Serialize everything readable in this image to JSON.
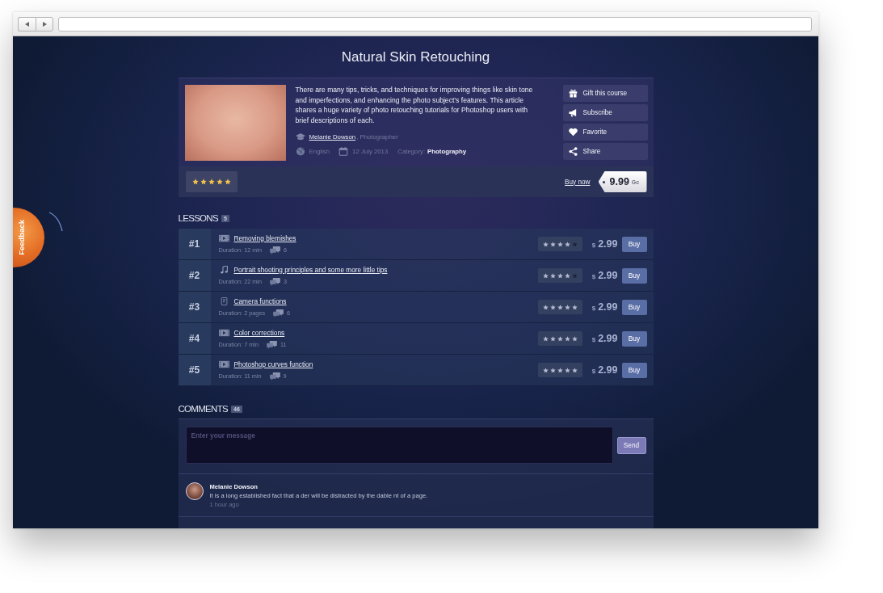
{
  "page": {
    "title": "Natural Skin Retouching"
  },
  "course": {
    "description": "There are many tips, tricks, and techniques for improving things like skin tone and imperfections, and enhancing the photo subject’s features. This article shares a huge variety of photo retouching tutorials for Photoshop users with brief descriptions of each.",
    "author": "Melanie Dowson",
    "author_role": ", Photographer",
    "language": "English",
    "date": "12 July 2013",
    "category_label": "Category:",
    "category": "Photography",
    "actions": [
      {
        "kind": "gift",
        "label": "Gift this course"
      },
      {
        "kind": "subscribe",
        "label": "Subscribe"
      },
      {
        "kind": "favorite",
        "label": "Favorite"
      },
      {
        "kind": "share",
        "label": "Share"
      }
    ],
    "rating": {
      "stars": 5
    },
    "buy_link": "Buy now",
    "price": {
      "amount": "9.99",
      "currency": "Gc"
    }
  },
  "lessons": {
    "title": "LESSONS",
    "count": "5",
    "items": [
      {
        "number": "#1",
        "kind": "video",
        "title": "Removing blemishes",
        "duration": "Duration: 12 min",
        "comments": "6",
        "stars": 4,
        "currency": "$",
        "price": "2.99",
        "buy_button": "Buy"
      },
      {
        "number": "#2",
        "kind": "audio",
        "title": "Portrait shooting principles and some more little tips",
        "duration": "Duration: 22 min",
        "comments": "3",
        "stars": 4,
        "currency": "$",
        "price": "2.99",
        "buy_button": "Buy"
      },
      {
        "number": "#3",
        "kind": "document",
        "title": "Camera functions",
        "duration": "Duration: 2 pages",
        "comments": "6",
        "stars": 5,
        "currency": "$",
        "price": "2.99",
        "buy_button": "Buy"
      },
      {
        "number": "#4",
        "kind": "video",
        "title": "Color corrections",
        "duration": "Duration: 7 min",
        "comments": "11",
        "stars": 5,
        "currency": "$",
        "price": "2.99",
        "buy_button": "Buy"
      },
      {
        "number": "#5",
        "kind": "video",
        "title": "Photoshop curves function",
        "duration": "Duration: 11 min",
        "comments": "9",
        "stars": 5,
        "currency": "$",
        "price": "2.99",
        "buy_button": "Buy"
      }
    ]
  },
  "comments": {
    "title": "COMMENTS",
    "count": "46",
    "input": {
      "placeholder": "Enter your message"
    },
    "send_button": "Send",
    "items": [
      {
        "author": "Melanie Dowson",
        "text": "It is a long established fact that a der will be distracted by the dable nt of a page.",
        "time": "1 hour ago"
      }
    ]
  },
  "feedback": {
    "label": "Feedback"
  }
}
